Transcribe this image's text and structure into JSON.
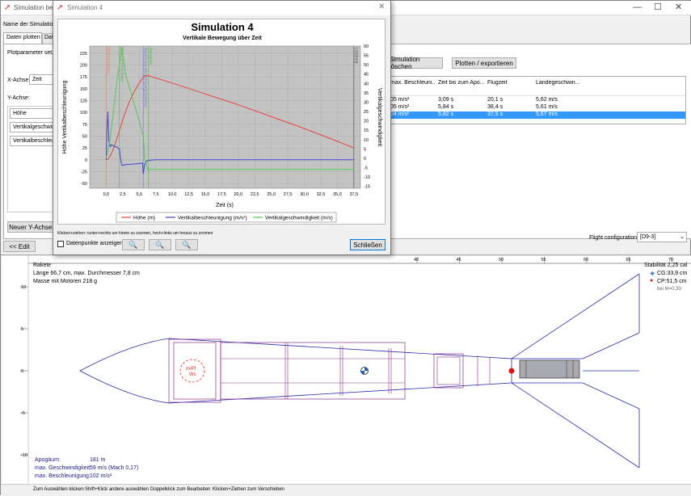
{
  "main_window": {
    "title": "Simulation bea",
    "sim_name_label": "Name der Simulation:",
    "tabs": [
      "Daten plotten",
      "Dat"
    ],
    "plot_params_label": "Plotparameter setze",
    "xaxis_label": "X-Achse:",
    "xaxis_value": "Zeit",
    "yaxis_label": "Y-Achse:",
    "y_series": [
      "Höhe",
      "Vertikalgeschwind",
      "Vertikalbeschleunig"
    ],
    "new_axis_btn": "Neuer Y-Achsen",
    "edit_btn": "<< Edit",
    "delete_sim_btn": "Simulation löschen",
    "plot_export_btn": "Plotten / exportieren",
    "flight_config_label": "Flight configuration:",
    "flight_config_value": "[D9-3]",
    "table": {
      "headers": [
        "max. Beschleuni...",
        "Zeit bis zum Apo...",
        "Flugzeit",
        "Landegeschwin..."
      ],
      "rows": [
        [
          "05 m/s²",
          "3,09 s",
          "20,1 s",
          "5,62 m/s"
        ],
        [
          "05 m/s²",
          "5,84 s",
          "38,4 s",
          "5,61 m/s"
        ],
        [
          "04 m/s²",
          "5,82 s",
          "37,5 s",
          "5,67 m/s"
        ]
      ]
    }
  },
  "dialog": {
    "title": "Simulation 4",
    "hint": "Klicken+ziehen: runter+rechts um hinein zu zoomen, hoch+links um heraus zu zoomen",
    "checkbox_label": "Datenpunkte anzeigen",
    "close_btn": "Schließen"
  },
  "chart_data": {
    "type": "line",
    "title": "Simulation 4",
    "subtitle": "Vertikale Bewegung über Zeit",
    "xlabel": "Zeit (s)",
    "ylabel_left": "Höhe Vertikalbeschleunigung",
    "ylabel_right": "Vertikalgeschwindigkeit",
    "xlim": [
      -2.5,
      38.5
    ],
    "ylim_left": [
      -60,
      240
    ],
    "ylim_right": [
      -16,
      60
    ],
    "x_ticks": [
      "0,0",
      "2,5",
      "5,0",
      "7,5",
      "10,0",
      "12,5",
      "15,0",
      "17,5",
      "20,0",
      "22,5",
      "25,0",
      "27,5",
      "30,0",
      "32,5",
      "35,0",
      "37,5"
    ],
    "y_ticks_left": [
      "225",
      "200",
      "175",
      "150",
      "125",
      "100",
      "75",
      "50",
      "25",
      "0",
      "-25",
      "-50"
    ],
    "y_ticks_right": [
      "60",
      "55",
      "50",
      "45",
      "40",
      "35",
      "30",
      "25",
      "20",
      "15",
      "10",
      "5",
      "0",
      "-5",
      "-10",
      "-15"
    ],
    "event_labels": [
      "Motorzündung",
      "Motorbrennschluss",
      "Auslösung des Bergungssystems",
      "Apogäum",
      "Landung"
    ],
    "event_colors": [
      "#e8896a",
      "#7aa37a",
      "#7d7dd6",
      "#55bb55",
      "#555555"
    ],
    "events_x": [
      0,
      2.0,
      5.6,
      6.4,
      37.5
    ],
    "series": [
      {
        "name": "Höhe (m)",
        "axis": "left",
        "color": "#e8453c",
        "x": [
          0,
          0.3,
          0.6,
          1.0,
          1.5,
          2.0,
          2.5,
          3.0,
          3.5,
          4.0,
          4.5,
          5.0,
          5.5,
          5.82,
          6.5,
          10,
          15,
          20,
          25,
          30,
          35,
          37.5
        ],
        "y": [
          0,
          2,
          8,
          20,
          40,
          62,
          84,
          104,
          122,
          137,
          150,
          162,
          172,
          178,
          177,
          162,
          139,
          116,
          91,
          66,
          39,
          25
        ]
      },
      {
        "name": "Vertikalbeschleunigung (m/s²)",
        "axis": "left",
        "color": "#4444cc",
        "x": [
          0,
          0.1,
          0.25,
          0.4,
          0.6,
          0.8,
          1.0,
          1.3,
          1.6,
          2.0,
          2.2,
          2.4,
          3.0,
          4.0,
          5.0,
          5.5,
          5.6,
          5.8,
          6.0,
          6.5,
          7.5,
          10,
          37.5
        ],
        "y": [
          0,
          60,
          102,
          40,
          28,
          32,
          30,
          28,
          27,
          22,
          0,
          -12,
          -10,
          -9,
          -8,
          -7,
          -30,
          -12,
          -3,
          -1,
          0,
          0,
          0
        ]
      },
      {
        "name": "Vertikalgeschwindigkeit (m/s)",
        "axis": "right",
        "color": "#55cc55",
        "x": [
          0,
          0.5,
          1.0,
          1.5,
          2.0,
          2.3,
          3.0,
          4.0,
          5.0,
          5.6,
          5.82,
          6.3,
          7.0,
          8.0,
          37.5
        ],
        "y": [
          0,
          8,
          22,
          38,
          50,
          60,
          44,
          32,
          20,
          12,
          0,
          -6,
          -6,
          -6,
          -6
        ]
      }
    ]
  },
  "rocket_view": {
    "name": "Rakete",
    "length_line": "Länge 66,7 cm, max. Durchmesser 7,8 cm",
    "mass_line": "Masse mit Motoren 218 g",
    "stability": "Stabilität 2,25 cal",
    "cg": "CG:33,9 cm",
    "cp": "CP:51,5 cm",
    "mach": "bei M=0,30",
    "stats_labels": [
      "Apogäum:",
      "max. Geschwindigkeit:",
      "max. Beschleunigung:"
    ],
    "stats_values": [
      "181 m",
      "59 m/s  (Mach 0,17)",
      "102 m/s²"
    ],
    "ruler_top": [
      "40",
      "45",
      "50",
      "55",
      "60",
      "65",
      "70"
    ],
    "ruler_left": [
      "10",
      "5",
      "0",
      "-5",
      "-10"
    ],
    "status_bar": [
      "Zum Auswählen klicken",
      "Shift+Klick andere auswählen",
      "Doppelklick zum Bearbeiten",
      "Klicken+Ziehen zum Verschieben"
    ]
  }
}
